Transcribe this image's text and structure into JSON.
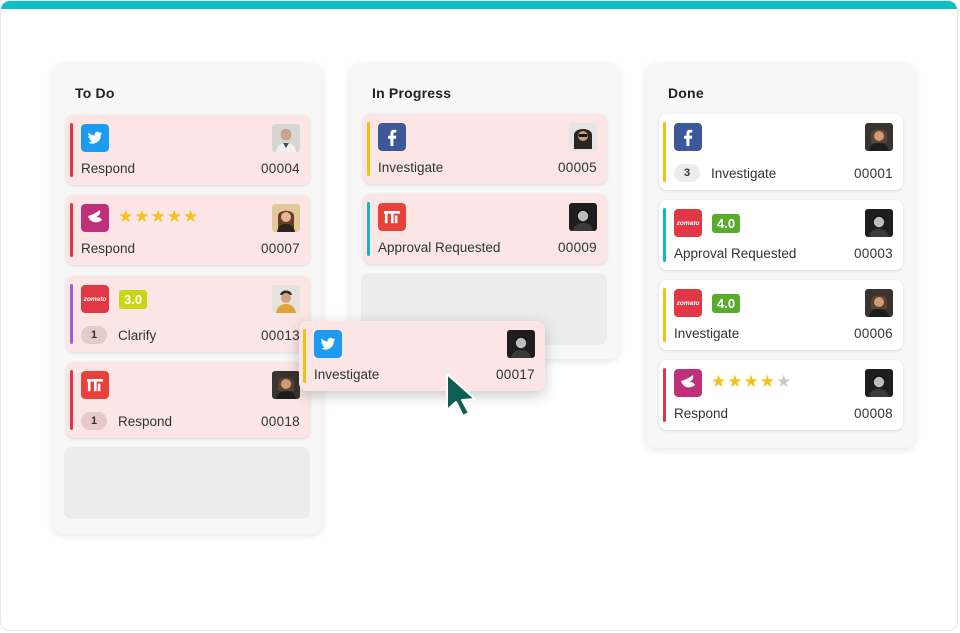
{
  "colors": {
    "accent": "#0abfc9",
    "stripe_red": "#e0344d",
    "stripe_purple": "#9b62d8",
    "stripe_yellow": "#f2c10e",
    "stripe_teal": "#11b6c9",
    "rating_lime": "#c8d414",
    "rating_green": "#5aaa2c",
    "cursor": "#0d5e54"
  },
  "columns": [
    {
      "title": "To Do",
      "cards": [
        {
          "source": "twitter-icon",
          "action": "Respond",
          "id": "00004"
        },
        {
          "source": "nykaa-icon",
          "stars": 5,
          "action": "Respond",
          "id": "00007"
        },
        {
          "source": "zomato-icon",
          "rating": "3.0",
          "count": "1",
          "action": "Clarify",
          "id": "00013"
        },
        {
          "source": "tt-icon",
          "count": "1",
          "action": "Respond",
          "id": "00018"
        }
      ]
    },
    {
      "title": "In Progress",
      "cards": [
        {
          "source": "facebook-icon",
          "action": "Investigate",
          "id": "00005"
        },
        {
          "source": "tt-icon",
          "action": "Approval Requested",
          "id": "00009"
        }
      ]
    },
    {
      "title": "Done",
      "cards": [
        {
          "source": "facebook-icon",
          "count": "3",
          "action": "Investigate",
          "id": "00001"
        },
        {
          "source": "zomato-icon",
          "rating": "4.0",
          "action": "Approval Requested",
          "id": "00003"
        },
        {
          "source": "zomato-icon",
          "rating": "4.0",
          "action": "Investigate",
          "id": "00006"
        },
        {
          "source": "nykaa-icon",
          "stars": 4,
          "action": "Respond",
          "id": "00008"
        }
      ]
    }
  ],
  "dragging": {
    "source": "twitter-icon",
    "action": "Investigate",
    "id": "00017"
  },
  "logo_text": {
    "zomato": "zomato"
  }
}
